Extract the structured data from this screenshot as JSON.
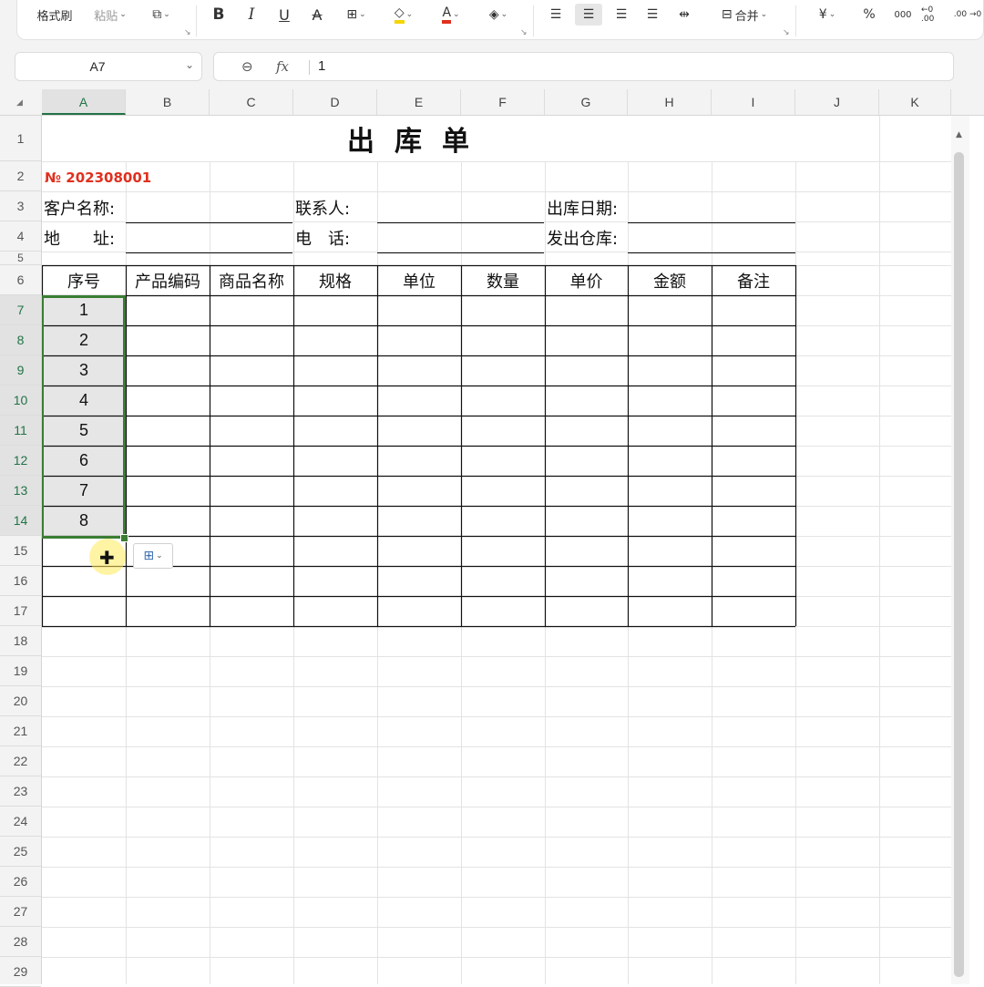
{
  "ribbon": {
    "format_painter": "格式刷",
    "paste": "粘贴",
    "bold": "B",
    "italic": "I",
    "underline": "U",
    "strike": "A",
    "fill_color": "#f5d400",
    "font_color": "#e0301e",
    "merge": "合并",
    "currency": "¥",
    "percent": "%",
    "thousands": "000",
    "inc_decimal": "←0 .00",
    "dec_decimal": ".00 →0"
  },
  "formula_bar": {
    "name_box": "A7",
    "fx_label": "fx",
    "value": "1"
  },
  "columns": [
    "A",
    "B",
    "C",
    "D",
    "E",
    "F",
    "G",
    "H",
    "I",
    "J",
    "K"
  ],
  "selected_column": "A",
  "rows": [
    "1",
    "2",
    "3",
    "4",
    "5",
    "6",
    "7",
    "8",
    "9",
    "10",
    "11",
    "12",
    "13",
    "14",
    "15",
    "16",
    "17",
    "18",
    "19",
    "20",
    "21",
    "22",
    "23",
    "24",
    "25",
    "26",
    "27",
    "28",
    "29"
  ],
  "selected_rows": [
    "7",
    "8",
    "9",
    "10",
    "11",
    "12",
    "13",
    "14"
  ],
  "sheet": {
    "title": "出库单",
    "doc_number": "№ 202308001",
    "customer_label": "客户名称:",
    "contact_label": "联系人:",
    "date_label": "出库日期:",
    "address_label": "地　　址:",
    "phone_label": "电　话:",
    "warehouse_label": "发出仓库:",
    "headers": [
      "序号",
      "产品编码",
      "商品名称",
      "规格",
      "单位",
      "数量",
      "单价",
      "金额",
      "备注"
    ],
    "serials": [
      "1",
      "2",
      "3",
      "4",
      "5",
      "6",
      "7",
      "8"
    ]
  },
  "colors": {
    "selection": "#3a7d33",
    "accent_green": "#217346",
    "doc_number_red": "#e0301e"
  }
}
